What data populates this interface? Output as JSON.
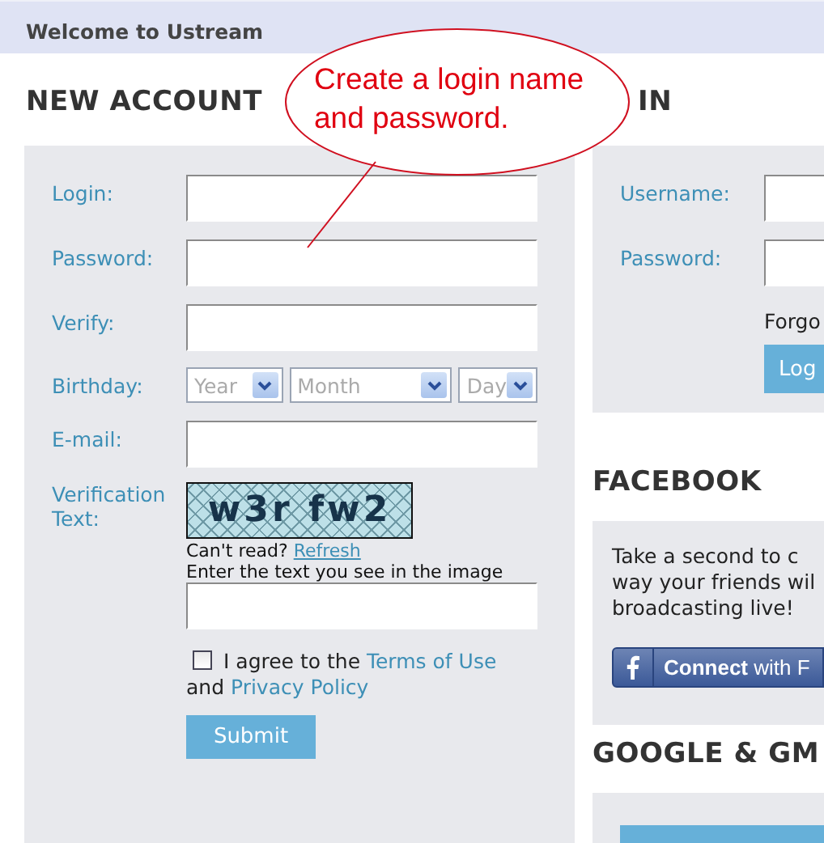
{
  "header": {
    "title": "Welcome to Ustream"
  },
  "callout": {
    "text": "Create a login name and password."
  },
  "new_account": {
    "heading": "NEW ACCOUNT",
    "fields": [
      {
        "label": "Login:",
        "kind": "text"
      },
      {
        "label": "Password:",
        "kind": "text"
      },
      {
        "label": "Verify:",
        "kind": "text"
      },
      {
        "label": "Birthday:",
        "kind": "selects",
        "selects": [
          "Year",
          "Month",
          "Day"
        ]
      },
      {
        "label": "E-mail:",
        "kind": "text"
      }
    ],
    "verification": {
      "label": "Verification Text:",
      "captcha": "w3r fw2",
      "cant_read": "Can't read?",
      "refresh_link": "Refresh",
      "hint": "Enter the text you see in the image"
    },
    "agreement": {
      "checked": false,
      "text": "I agree to the",
      "terms_link": "Terms of Use",
      "joiner": "and",
      "privacy_link": "Privacy Policy"
    },
    "submit": "Submit"
  },
  "login": {
    "heading": "IN",
    "fields": [
      "Username:",
      "Password:"
    ],
    "forgot": "Forgo",
    "button": "Log"
  },
  "facebook": {
    "heading": "FACEBOOK",
    "lines": [
      "Take a second to c",
      "way your friends wil",
      "broadcasting live!"
    ],
    "button": "**Connect** with F"
  },
  "google": {
    "heading": "GOOGLE & GM"
  }
}
